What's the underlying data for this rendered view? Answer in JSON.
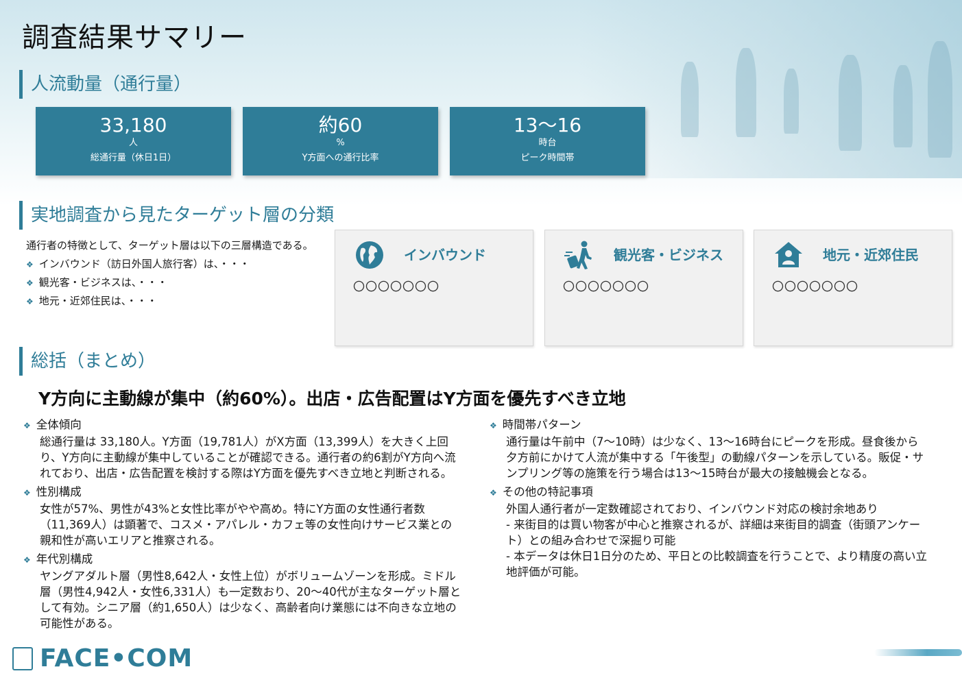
{
  "page": {
    "title": "調査結果サマリー"
  },
  "sections": {
    "traffic": "人流動量（通行量）",
    "segments": "実地調査から見たターゲット層の分類",
    "summary": "総括（まとめ）"
  },
  "kpis": [
    {
      "value": "33,180",
      "unit": "人",
      "label": "総通行量（休日1日）"
    },
    {
      "value": "約60",
      "unit": "%",
      "label": "Y方面への通行比率"
    },
    {
      "value": "13～16",
      "unit": "時台",
      "label": "ピーク時間帯"
    }
  ],
  "intro": {
    "lead": "通行者の特徴として、ターゲット層は以下の三層構造である。",
    "bullets": [
      "インバウンド（訪日外国人旅行客）は、・・・",
      "観光客・ビジネスは、・・・",
      "地元・近郊住民は、・・・"
    ]
  },
  "cards": [
    {
      "title": "インバウンド",
      "body": "〇〇〇〇〇〇〇",
      "icon": "globe-icon"
    },
    {
      "title": "観光客・ビジネス",
      "body": "〇〇〇〇〇〇〇",
      "icon": "traveler-icon"
    },
    {
      "title": "地元・近郊住民",
      "body": "〇〇〇〇〇〇〇",
      "icon": "home-person-icon"
    }
  ],
  "conclusion": "Y方向に主動線が集中（約60%）。出店・広告配置はY方面を優先すべき立地",
  "left_items": [
    {
      "heading": "全体傾向",
      "body": "総通行量は 33,180人。Y方面（19,781人）がX方面（13,399人）を大きく上回り、Y方向に主動線が集中していることが確認できる。通行者の約6割がY方向へ流れており、出店・広告配置を検討する際はY方面を優先すべき立地と判断される。"
    },
    {
      "heading": "性別構成",
      "body": "女性が57%、男性が43%と女性比率がやや高め。特にY方面の女性通行者数（11,369人）は顕著で、コスメ・アパレル・カフェ等の女性向けサービス業との親和性が高いエリアと推察される。"
    },
    {
      "heading": "年代別構成",
      "body": "ヤングアダルト層（男性8,642人・女性上位）がボリュームゾーンを形成。ミドル層（男性4,942人・女性6,331人）も一定数おり、20～40代が主なターゲット層として有効。シニア層（約1,650人）は少なく、高齢者向け業態には不向きな立地の可能性がある。"
    }
  ],
  "right_items": [
    {
      "heading": "時間帯パターン",
      "body": "通行量は午前中（7～10時）は少なく、13～16時台にピークを形成。昼食後から夕方前にかけて人流が集中する「午後型」の動線パターンを示している。販促・サンプリング等の施策を行う場合は13～15時台が最大の接触機会となる。"
    },
    {
      "heading": "その他の特記事項",
      "body_lines": [
        "外国人通行者が一定数確認されており、インバウンド対応の検討余地あり",
        "- 来街目的は買い物客が中心と推察されるが、詳細は来街目的調査（街頭アンケート）との組み合わせで深掘り可能",
        "- 本データは休日1日分のため、平日との比較調査を行うことで、より精度の高い立地評価が可能。"
      ]
    }
  ],
  "logo": {
    "text": "FACE•COM"
  },
  "colors": {
    "accent": "#2f7d98",
    "card_bg": "#f1f1f1"
  }
}
